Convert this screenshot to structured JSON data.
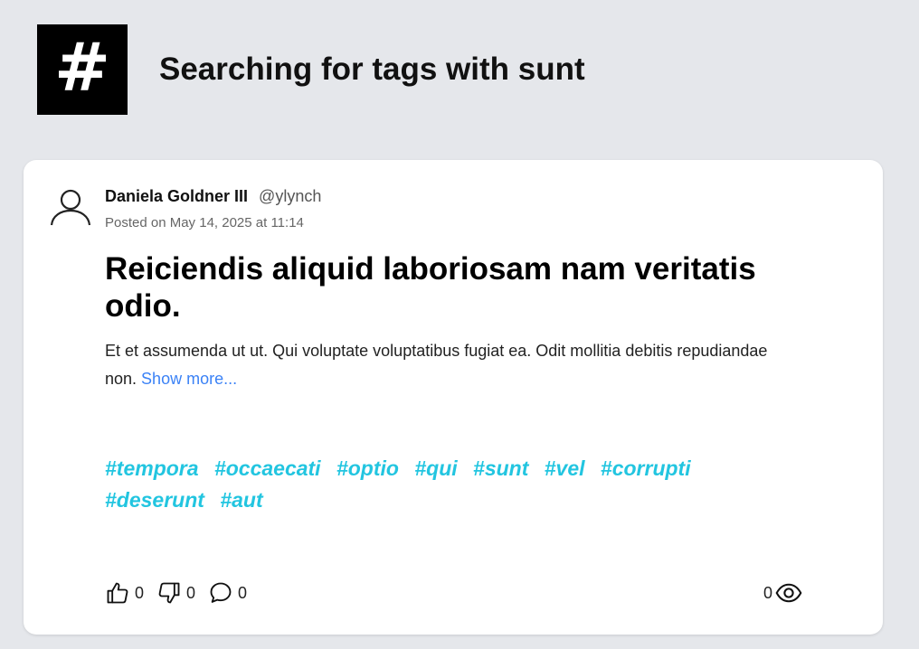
{
  "header": {
    "logo_symbol": "#",
    "title": "Searching for tags with sunt"
  },
  "post": {
    "author_name": "Daniela Goldner III",
    "author_handle": "@ylynch",
    "posted": "Posted on May 14, 2025 at 11:14",
    "title": "Reiciendis aliquid laboriosam nam veritatis odio.",
    "excerpt": "Et et assumenda ut ut. Qui voluptate voluptatibus fugiat ea. Odit mollitia debitis repudiandae non. ",
    "show_more": "Show more...",
    "tags": [
      "#tempora",
      "#occaecati",
      "#optio",
      "#qui",
      "#sunt",
      "#vel",
      "#corrupti",
      "#deserunt",
      "#aut"
    ],
    "likes": "0",
    "dislikes": "0",
    "comments": "0",
    "views": "0"
  },
  "icons": {
    "avatar": "user-outline-icon",
    "like": "thumbs-up-icon",
    "dislike": "thumbs-down-icon",
    "comment": "speech-bubble-icon",
    "views": "eye-icon"
  },
  "colors": {
    "background": "#e5e7eb",
    "tag": "#22c5e0",
    "link": "#3b82f6"
  }
}
